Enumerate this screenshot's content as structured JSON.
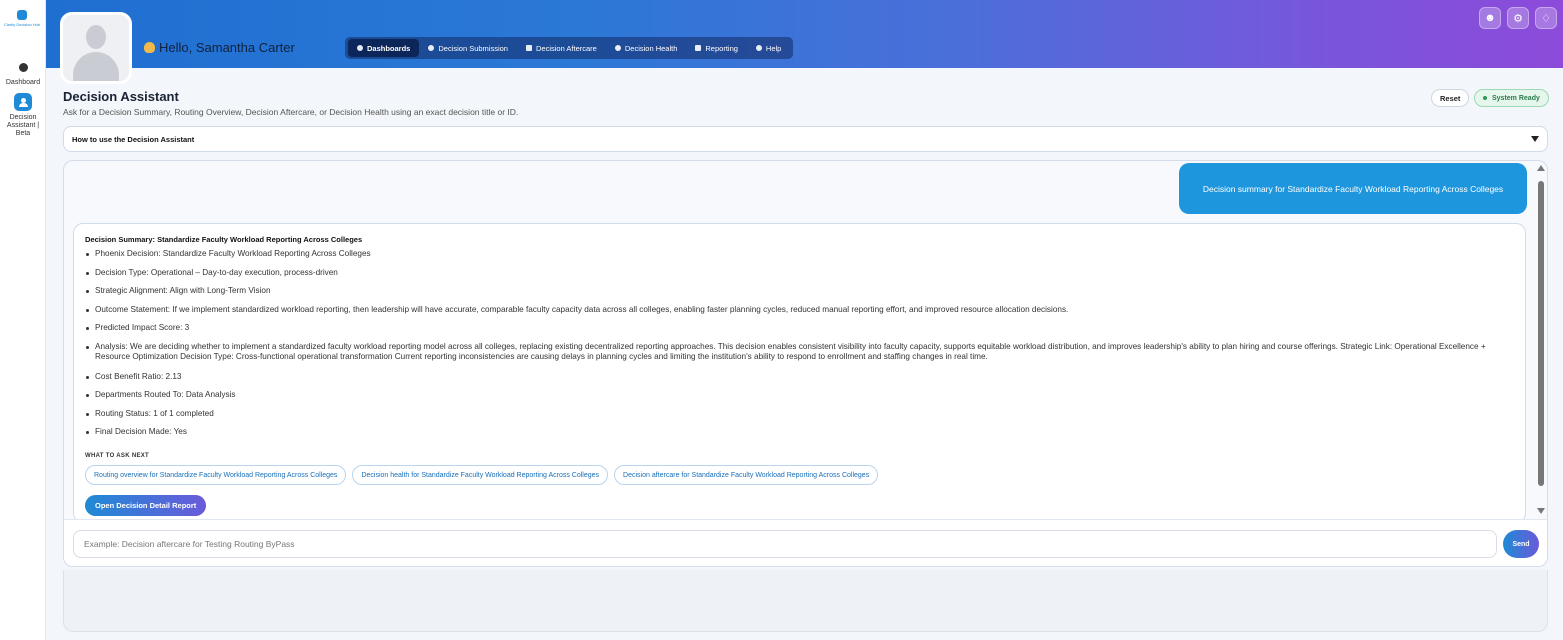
{
  "rail": {
    "logo_text": "Clarity Decision Hub",
    "items": [
      {
        "label": "Dashboard",
        "icon": "dashboard-icon"
      },
      {
        "label": "Decision Assistant | Beta",
        "icon": "assistant-icon"
      }
    ]
  },
  "header": {
    "greeting": "Hello, Samantha Carter",
    "nav": [
      {
        "label": "Dashboards",
        "icon": "dashboard-icon",
        "active": true
      },
      {
        "label": "Decision Submission",
        "icon": "pin-icon"
      },
      {
        "label": "Decision Aftercare",
        "icon": "aftercare-icon"
      },
      {
        "label": "Decision Health",
        "icon": "health-icon"
      },
      {
        "label": "Reporting",
        "icon": "reporting-icon"
      },
      {
        "label": "Help",
        "icon": "help-icon"
      }
    ],
    "actions": [
      {
        "icon": "accessibility-icon"
      },
      {
        "icon": "gear-icon"
      },
      {
        "icon": "bell-icon"
      }
    ]
  },
  "main": {
    "title": "Decision Assistant",
    "subtitle": "Ask for a Decision Summary, Routing Overview, Decision Aftercare, or Decision Health using an exact decision title or ID.",
    "reset_label": "Reset",
    "status_label": "System Ready",
    "accordion_label": "How to use the Decision Assistant"
  },
  "chat": {
    "user_message": "Decision summary for Standardize Faculty Workload Reporting Across Colleges",
    "reply": {
      "title": "Decision Summary: Standardize Faculty Workload Reporting Across Colleges",
      "facts": [
        "Phoenix Decision: Standardize Faculty Workload Reporting Across Colleges",
        "Decision Type: Operational – Day-to-day execution, process-driven",
        "Strategic Alignment: Align with Long-Term Vision",
        "Outcome Statement: If we implement standardized workload reporting, then leadership will have accurate, comparable faculty capacity data across all colleges, enabling faster planning cycles, reduced manual reporting effort, and improved resource allocation decisions.",
        "Predicted Impact Score: 3",
        "Analysis: We are deciding whether to implement a standardized faculty workload reporting model across all colleges, replacing existing decentralized reporting approaches. This decision enables consistent visibility into faculty capacity, supports equitable workload distribution, and improves leadership's ability to plan hiring and course offerings. Strategic Link: Operational Excellence + Resource Optimization Decision Type: Cross-functional operational transformation Current reporting inconsistencies are causing delays in planning cycles and limiting the institution's ability to respond to enrollment and staffing changes in real time.",
        "Cost Benefit Ratio: 2.13",
        "Departments Routed To: Data Analysis",
        "Routing Status: 1 of 1 completed",
        "Final Decision Made: Yes"
      ],
      "next_label": "WHAT TO ASK NEXT",
      "suggestions": [
        "Routing overview for Standardize Faculty Workload Reporting Across Colleges",
        "Decision health for Standardize Faculty Workload Reporting Across Colleges",
        "Decision aftercare for Standardize Faculty Workload Reporting Across Colleges"
      ],
      "report_button": "Open Decision Detail Report"
    },
    "input_placeholder": "Example: Decision aftercare for Testing Routing ByPass",
    "input_value": "",
    "send_label": "Send"
  },
  "colors": {
    "accent": "#1f8ad6",
    "banner_start": "#1f6fd1",
    "banner_end": "#8c4bd9",
    "status_green": "#2e7a4b"
  }
}
